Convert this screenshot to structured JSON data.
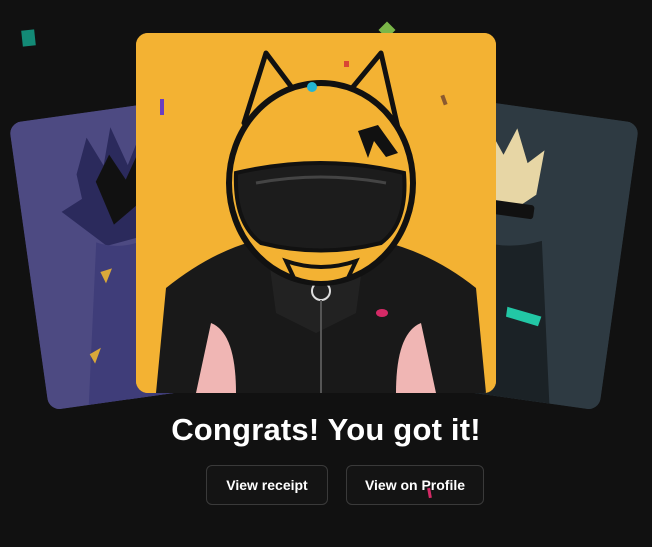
{
  "headline": "Congrats! You got it!",
  "buttons": {
    "receipt_label": "View receipt",
    "profile_label": "View on Profile"
  },
  "colors": {
    "background": "#111111",
    "main_card": "#f3b233",
    "left_card": "#4d4a82",
    "right_card": "#2e3a42",
    "button_border": "#3a3a3a"
  }
}
